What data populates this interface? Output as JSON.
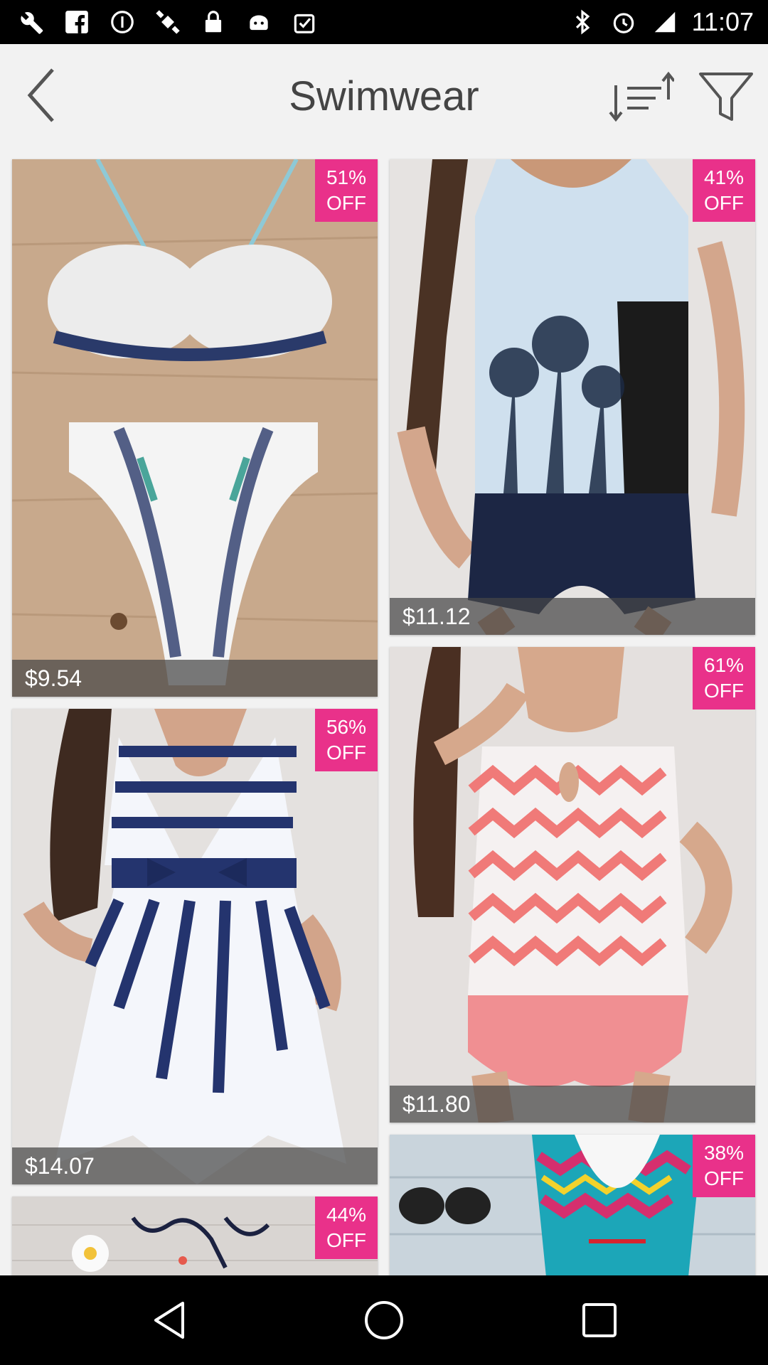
{
  "status_bar": {
    "time": "11:07",
    "left_icons": [
      "wrench-icon",
      "facebook-icon",
      "info-icon",
      "fake-gps-icon",
      "lock-icon",
      "android-icon",
      "clipboard-check-icon"
    ],
    "right_icons": [
      "bluetooth-icon",
      "alarm-icon",
      "signal-icon"
    ]
  },
  "header": {
    "title": "Swimwear",
    "back_icon": "chevron-left-icon",
    "sort_icon": "sort-icon",
    "filter_icon": "filter-icon"
  },
  "products": [
    {
      "discount_pct": "51%",
      "discount_off": "OFF",
      "price": "$9.54",
      "image": "white-floral-bikini"
    },
    {
      "discount_pct": "41%",
      "discount_off": "OFF",
      "price": "$11.12",
      "image": "palm-print-tankini"
    },
    {
      "discount_pct": "61%",
      "discount_off": "OFF",
      "price": "$11.80",
      "image": "anchor-chevron-tankini"
    },
    {
      "discount_pct": "56%",
      "discount_off": "OFF",
      "price": "$14.07",
      "image": "striped-swim-dress"
    },
    {
      "discount_pct": "44%",
      "discount_off": "OFF",
      "price": "",
      "image": "tie-bikini-flat"
    },
    {
      "discount_pct": "38%",
      "discount_off": "OFF",
      "price": "",
      "image": "tribal-print-swimsuit"
    }
  ],
  "colors": {
    "badge": "#e9318a",
    "background": "#f2f2f2",
    "title": "#444444"
  },
  "nav_bar": {
    "icons": [
      "back-triangle-icon",
      "home-circle-icon",
      "recents-square-icon"
    ]
  }
}
